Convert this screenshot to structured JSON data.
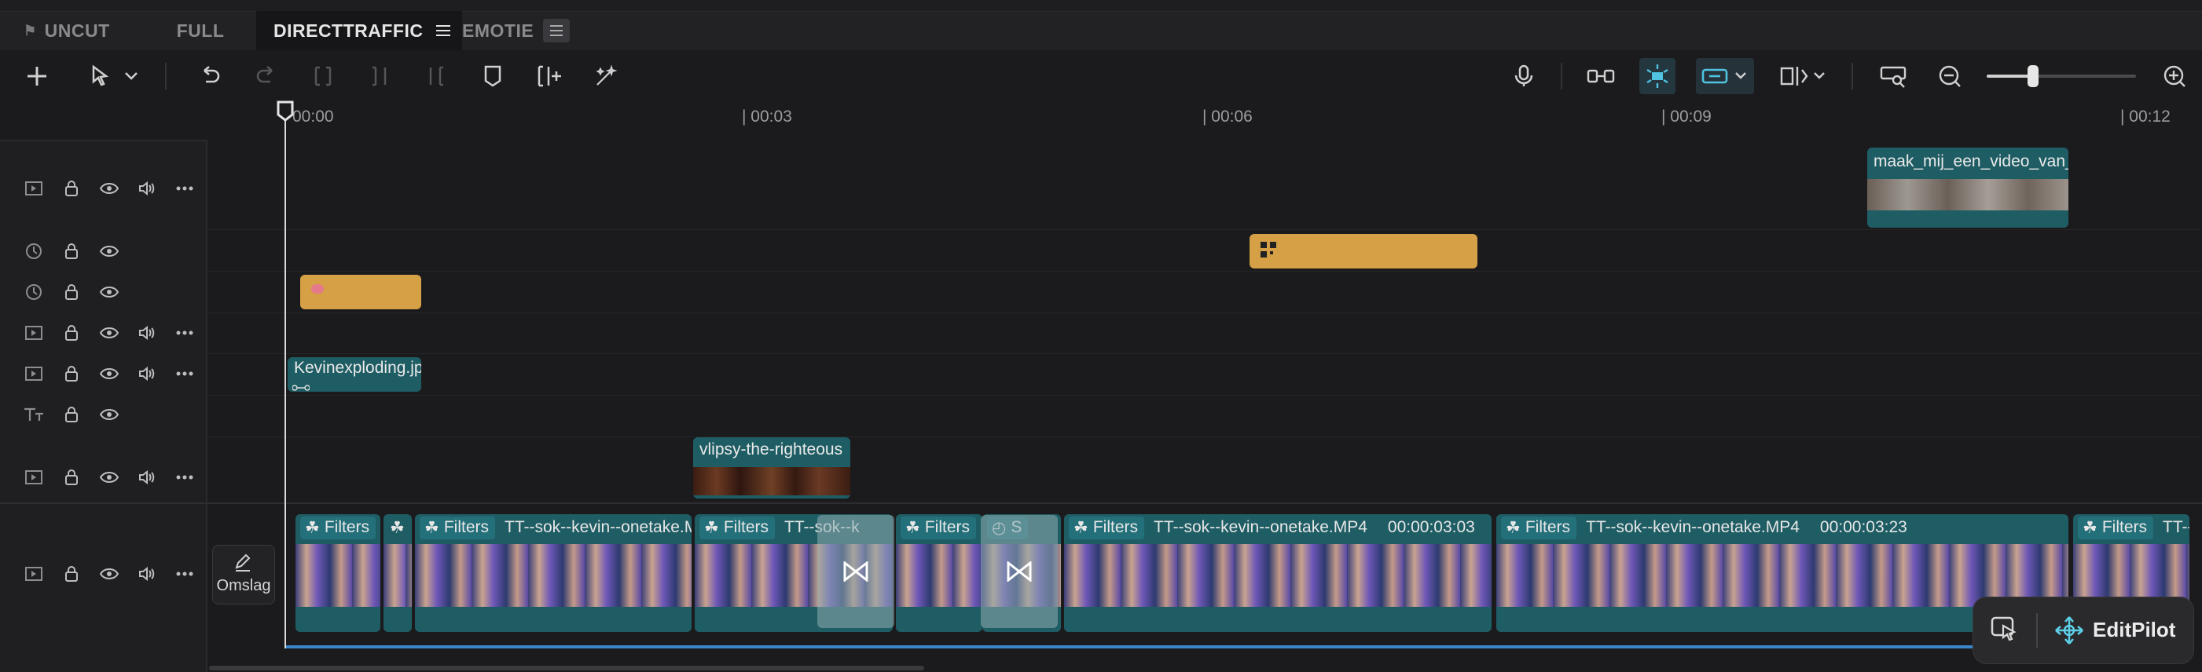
{
  "tabs": [
    {
      "label": "UNCUT",
      "pinned": true,
      "active": false
    },
    {
      "label": "FULL",
      "active": false
    },
    {
      "label": "DIRECTTRAFFIC",
      "active": true
    },
    {
      "label": "EMOTIE",
      "active": false
    }
  ],
  "toolbar": {
    "left": [
      "add-icon",
      "select-arrow-icon",
      "chevron-down-icon",
      "undo-icon",
      "redo-icon",
      "split-icon",
      "trim-left-icon",
      "trim-right-icon",
      "marker-icon",
      "insert-icon",
      "magic-wand-icon"
    ],
    "right": [
      "microphone-icon",
      "link-clips-icon",
      "auto-snap-icon",
      "linked-icon",
      "preview-split-icon",
      "fit-timeline-icon",
      "zoom-out-icon",
      "zoom-slider",
      "zoom-in-icon"
    ],
    "zoom_level": 0.25
  },
  "ruler": {
    "ticks": [
      "00:00",
      "| 00:03",
      "| 00:06",
      "| 00:09",
      "| 00:12"
    ]
  },
  "tracks": [
    {
      "type": "video",
      "controls": [
        "video-icon",
        "lock-icon",
        "eye-icon",
        "audio-icon",
        "more-icon"
      ]
    },
    {
      "type": "effect",
      "controls": [
        "clock-icon",
        "lock-icon",
        "eye-icon"
      ]
    },
    {
      "type": "effect",
      "controls": [
        "clock-icon",
        "lock-icon",
        "eye-icon"
      ]
    },
    {
      "type": "video",
      "controls": [
        "video-icon",
        "lock-icon",
        "eye-icon",
        "audio-icon",
        "more-icon"
      ]
    },
    {
      "type": "video",
      "controls": [
        "video-icon",
        "lock-icon",
        "eye-icon",
        "audio-icon",
        "more-icon"
      ]
    },
    {
      "type": "text",
      "controls": [
        "text-icon",
        "lock-icon",
        "eye-icon"
      ]
    },
    {
      "type": "video",
      "controls": [
        "video-icon",
        "lock-icon",
        "eye-icon",
        "audio-icon",
        "more-icon"
      ]
    },
    {
      "type": "main",
      "controls": [
        "video-icon",
        "lock-icon",
        "eye-icon",
        "audio-icon",
        "more-icon"
      ]
    }
  ],
  "clips": {
    "overlay_video_top": "maak_mij_een_video_van_du",
    "kevin_image": "Kevinexploding.jp",
    "vlipsy": "vlipsy-the-righteous"
  },
  "main_clips": [
    {
      "filters": "Filters",
      "name": "",
      "duration": ""
    },
    {
      "filters": "",
      "name": "",
      "duration": ""
    },
    {
      "filters": "Filters",
      "name": "TT--sok--kevin--onetake.M",
      "duration": ""
    },
    {
      "filters": "Filters",
      "name": "TT--sok--k",
      "duration": ""
    },
    {
      "filters": "Filters",
      "name": "",
      "duration": ""
    },
    {
      "filters": "S",
      "name": "",
      "duration": ""
    },
    {
      "filters": "Filters",
      "name": "TT--sok--kevin--onetake.MP4",
      "duration": "00:00:03:03"
    },
    {
      "filters": "Filters",
      "name": "TT--sok--kevin--onetake.MP4",
      "duration": "00:00:03:23"
    },
    {
      "filters": "Filters",
      "name": "TT--",
      "duration": ""
    }
  ],
  "cover": {
    "label": "Omslag"
  },
  "editpilot": {
    "label": "EditPilot"
  },
  "colors": {
    "accent": "#1f5d64",
    "orange": "#d6a146",
    "highlight": "#3a86c8"
  }
}
